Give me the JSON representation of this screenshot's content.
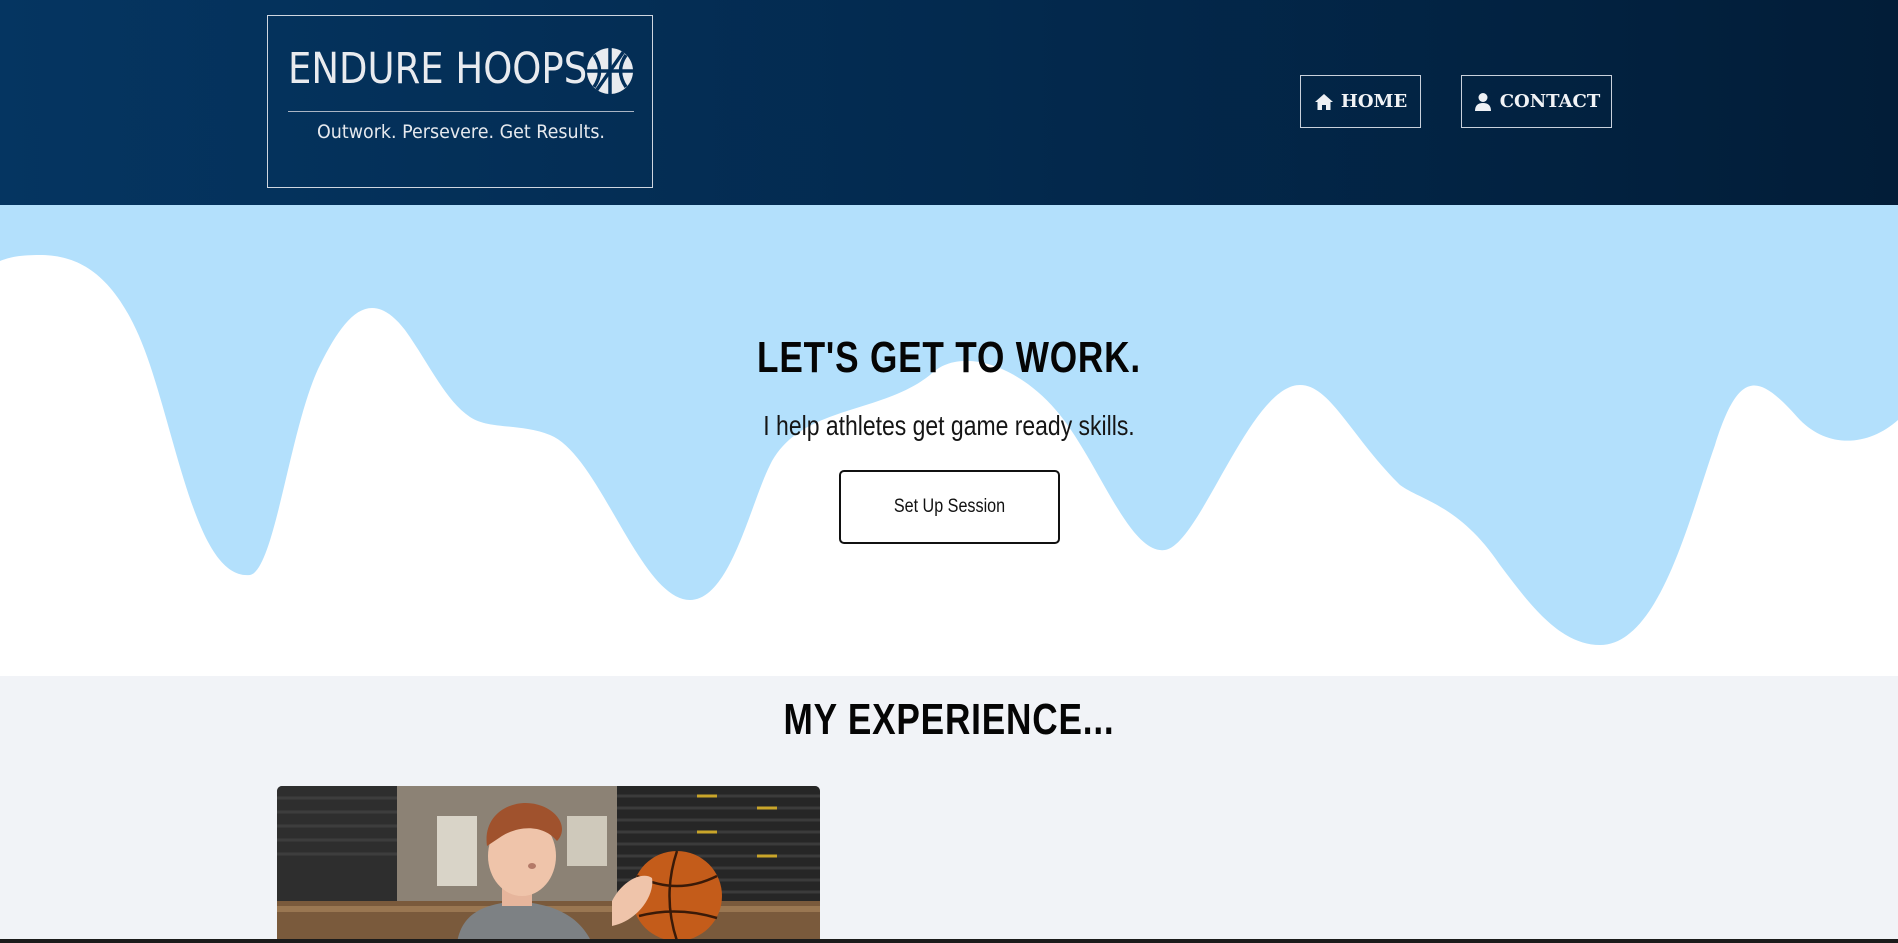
{
  "header": {
    "logo": {
      "title": "ENDURE HOOPS",
      "tagline": "Outwork. Persevere. Get Results.",
      "icon": "basketball-icon"
    },
    "nav": [
      {
        "label": "HOME",
        "icon": "home-icon"
      },
      {
        "label": "CONTACT",
        "icon": "user-icon"
      }
    ]
  },
  "hero": {
    "title": "LET'S GET TO WORK.",
    "subtitle": "I help athletes get game ready skills.",
    "cta_label": "Set Up Session",
    "wave_color": "#b3e0fc"
  },
  "experience": {
    "title": "MY EXPERIENCE...",
    "photo": "basketball-player-photo"
  },
  "colors": {
    "header_bg": "#04305a",
    "section_bg": "#f1f3f7",
    "wave": "#b3e0fc"
  }
}
